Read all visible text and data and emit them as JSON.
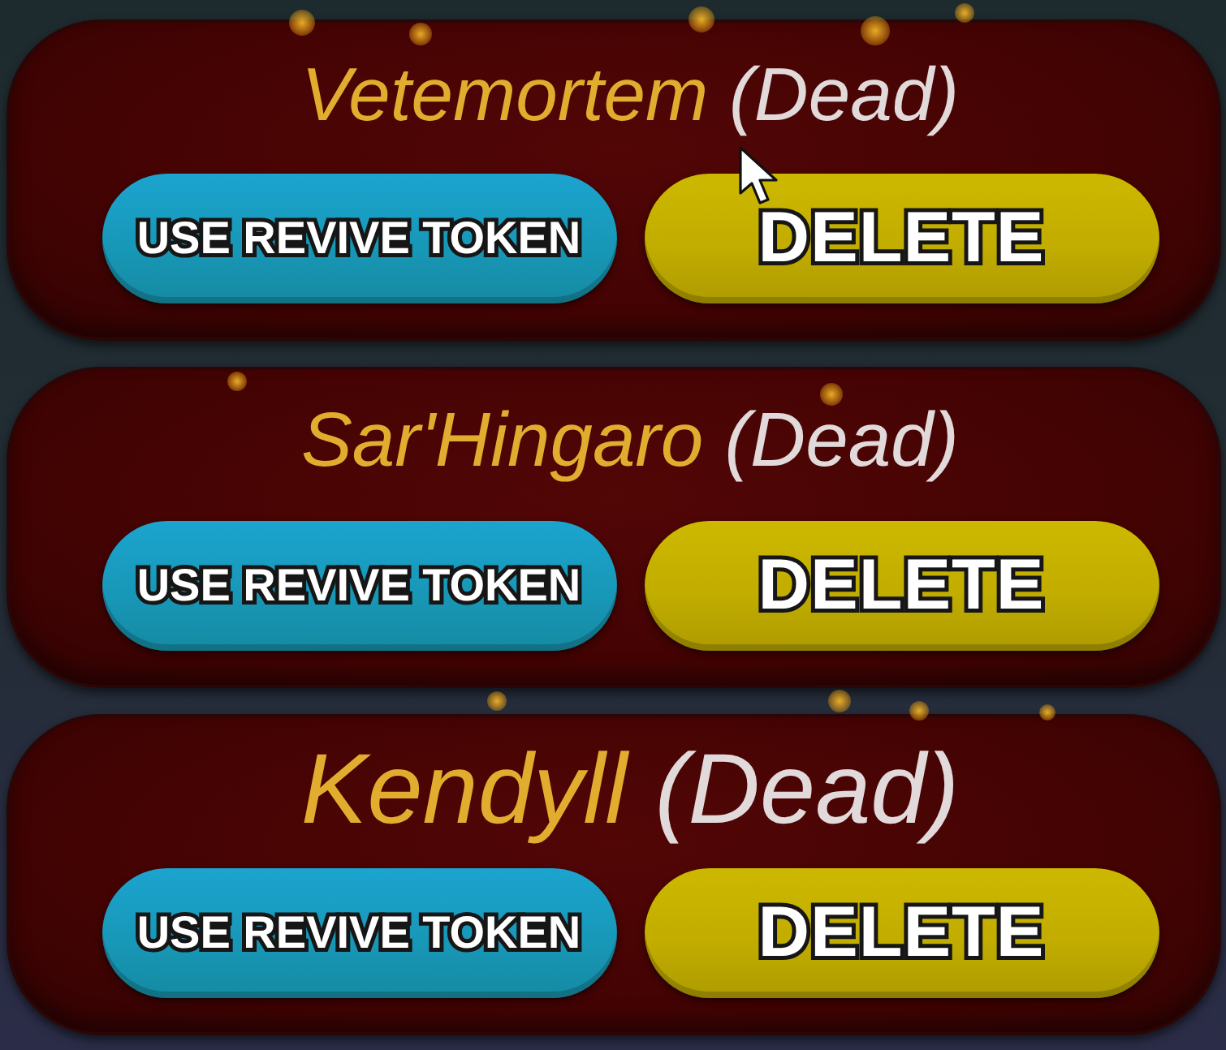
{
  "characters": [
    {
      "name": "Vetemortem",
      "status": "(Dead)",
      "actions": [
        {
          "kind": "revive",
          "label": "USE REVIVE TOKEN"
        },
        {
          "kind": "delete",
          "label": "DELETE"
        }
      ]
    },
    {
      "name": "Sar'Hingaro",
      "status": "(Dead)",
      "actions": [
        {
          "kind": "revive",
          "label": "USE REVIVE TOKEN"
        },
        {
          "kind": "delete",
          "label": "DELETE"
        }
      ]
    },
    {
      "name": "Kendyll",
      "status": "(Dead)",
      "actions": [
        {
          "kind": "revive",
          "label": "USE REVIVE TOKEN"
        },
        {
          "kind": "delete",
          "label": "DELETE"
        }
      ]
    }
  ]
}
